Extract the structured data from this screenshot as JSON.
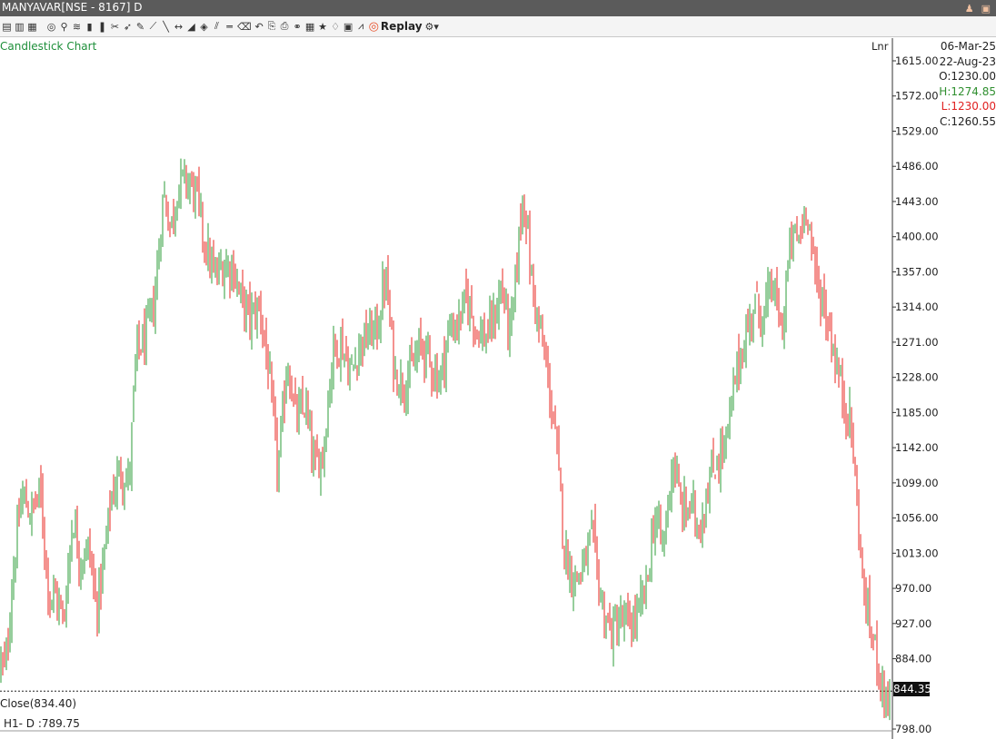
{
  "window": {
    "title": "MANYAVAR[NSE - 8167] D"
  },
  "toolbar": {
    "items": [
      {
        "name": "chart-type-icon",
        "glyph": "▤"
      },
      {
        "name": "chart-type-2-icon",
        "glyph": "▥"
      },
      {
        "name": "chart-type-3-icon",
        "glyph": "▦"
      },
      {
        "name": "sep"
      },
      {
        "name": "indicator-icon",
        "glyph": "◎"
      },
      {
        "name": "pin-icon",
        "glyph": "⚲"
      },
      {
        "name": "study-icon",
        "glyph": "≋"
      },
      {
        "name": "bars-icon",
        "glyph": "▮"
      },
      {
        "name": "volume-icon",
        "glyph": "❚"
      },
      {
        "name": "scissors-icon",
        "glyph": "✂"
      },
      {
        "name": "cursor-icon",
        "glyph": "➶"
      },
      {
        "name": "pencil-icon",
        "glyph": "✎"
      },
      {
        "name": "ruler-icon",
        "glyph": "⟋"
      },
      {
        "name": "trendline-icon",
        "glyph": "╲"
      },
      {
        "name": "hline-icon",
        "glyph": "↔"
      },
      {
        "name": "fib-icon",
        "glyph": "◢"
      },
      {
        "name": "box-icon",
        "glyph": "◈"
      },
      {
        "name": "parallel-icon",
        "glyph": "⫽"
      },
      {
        "name": "equals-icon",
        "glyph": "═"
      },
      {
        "name": "eraser-icon",
        "glyph": "⌫"
      },
      {
        "name": "undo-icon",
        "glyph": "↶"
      },
      {
        "name": "export-icon",
        "glyph": "⎘"
      },
      {
        "name": "print-icon",
        "glyph": "⎙"
      },
      {
        "name": "link-icon",
        "glyph": "⚭"
      },
      {
        "name": "table-icon",
        "glyph": "▦"
      },
      {
        "name": "star-icon",
        "glyph": "★"
      },
      {
        "name": "alert-icon",
        "glyph": "♢"
      },
      {
        "name": "save-icon",
        "glyph": "▣"
      },
      {
        "name": "graph-icon",
        "glyph": "⩘"
      }
    ],
    "replay_label": "Replay",
    "settings_glyph": "⚙"
  },
  "chart": {
    "title": "Candlestick Chart",
    "scale_mode": "Lnr",
    "close_label": "Close(834.40)",
    "hl_label": "H1- D :789.75",
    "last_price": "844.35",
    "colors": {
      "up": "#2e9e3a",
      "down": "#e8251f",
      "axis": "#333333"
    }
  },
  "info": {
    "date_to": "06-Mar-25",
    "date_from": "22-Aug-23",
    "open": "O:1230.00",
    "high": "H:1274.85",
    "low": "L:1230.00",
    "close": "C:1260.55"
  },
  "chart_data": {
    "type": "candlestick",
    "x_range": [
      "22-Aug-23",
      "06-Mar-25"
    ],
    "ylim": [
      790,
      1630
    ],
    "y_ticks": [
      "1615.00",
      "1572.00",
      "1529.00",
      "1486.00",
      "1443.00",
      "1400.00",
      "1357.00",
      "1314.00",
      "1271.00",
      "1228.00",
      "1185.00",
      "1142.00",
      "1099.00",
      "1056.00",
      "1013.00",
      "970.00",
      "927.00",
      "884.00",
      "798.00"
    ],
    "series": {
      "anchors_close": [
        [
          0,
          880
        ],
        [
          6,
          870
        ],
        [
          14,
          985
        ],
        [
          24,
          1085
        ],
        [
          34,
          1060
        ],
        [
          44,
          1090
        ],
        [
          54,
          960
        ],
        [
          62,
          960
        ],
        [
          70,
          930
        ],
        [
          80,
          1060
        ],
        [
          88,
          1005
        ],
        [
          98,
          1020
        ],
        [
          106,
          945
        ],
        [
          114,
          1000
        ],
        [
          122,
          1080
        ],
        [
          132,
          1115
        ],
        [
          142,
          1100
        ],
        [
          150,
          1260
        ],
        [
          160,
          1275
        ],
        [
          170,
          1320
        ],
        [
          180,
          1455
        ],
        [
          188,
          1410
        ],
        [
          196,
          1465
        ],
        [
          206,
          1470
        ],
        [
          216,
          1450
        ],
        [
          226,
          1390
        ],
        [
          236,
          1350
        ],
        [
          246,
          1365
        ],
        [
          256,
          1365
        ],
        [
          266,
          1320
        ],
        [
          276,
          1300
        ],
        [
          286,
          1315
        ],
        [
          296,
          1230
        ],
        [
          306,
          1110
        ],
        [
          316,
          1250
        ],
        [
          326,
          1175
        ],
        [
          336,
          1195
        ],
        [
          346,
          1115
        ],
        [
          356,
          1140
        ],
        [
          366,
          1260
        ],
        [
          376,
          1270
        ],
        [
          386,
          1230
        ],
        [
          396,
          1270
        ],
        [
          406,
          1280
        ],
        [
          416,
          1290
        ],
        [
          424,
          1355
        ],
        [
          434,
          1235
        ],
        [
          444,
          1220
        ],
        [
          454,
          1240
        ],
        [
          464,
          1270
        ],
        [
          474,
          1245
        ],
        [
          484,
          1225
        ],
        [
          494,
          1285
        ],
        [
          504,
          1295
        ],
        [
          514,
          1325
        ],
        [
          524,
          1290
        ],
        [
          534,
          1275
        ],
        [
          544,
          1300
        ],
        [
          552,
          1340
        ],
        [
          562,
          1275
        ],
        [
          570,
          1385
        ],
        [
          576,
          1460
        ],
        [
          584,
          1355
        ],
        [
          592,
          1295
        ],
        [
          602,
          1235
        ],
        [
          612,
          1145
        ],
        [
          622,
          1010
        ],
        [
          632,
          980
        ],
        [
          642,
          995
        ],
        [
          652,
          1035
        ],
        [
          662,
          950
        ],
        [
          672,
          915
        ],
        [
          682,
          930
        ],
        [
          692,
          925
        ],
        [
          702,
          935
        ],
        [
          712,
          975
        ],
        [
          720,
          1060
        ],
        [
          730,
          1020
        ],
        [
          740,
          1130
        ],
        [
          750,
          1065
        ],
        [
          760,
          1070
        ],
        [
          770,
          1045
        ],
        [
          780,
          1100
        ],
        [
          790,
          1130
        ],
        [
          800,
          1150
        ],
        [
          810,
          1235
        ],
        [
          820,
          1275
        ],
        [
          830,
          1320
        ],
        [
          840,
          1300
        ],
        [
          850,
          1345
        ],
        [
          860,
          1280
        ],
        [
          870,
          1395
        ],
        [
          880,
          1400
        ],
        [
          888,
          1445
        ],
        [
          896,
          1355
        ],
        [
          906,
          1320
        ],
        [
          916,
          1270
        ],
        [
          926,
          1210
        ],
        [
          936,
          1175
        ],
        [
          946,
          1030
        ],
        [
          950,
          965
        ],
        [
          958,
          920
        ],
        [
          966,
          880
        ],
        [
          974,
          835
        ],
        [
          980,
          840
        ]
      ]
    }
  }
}
